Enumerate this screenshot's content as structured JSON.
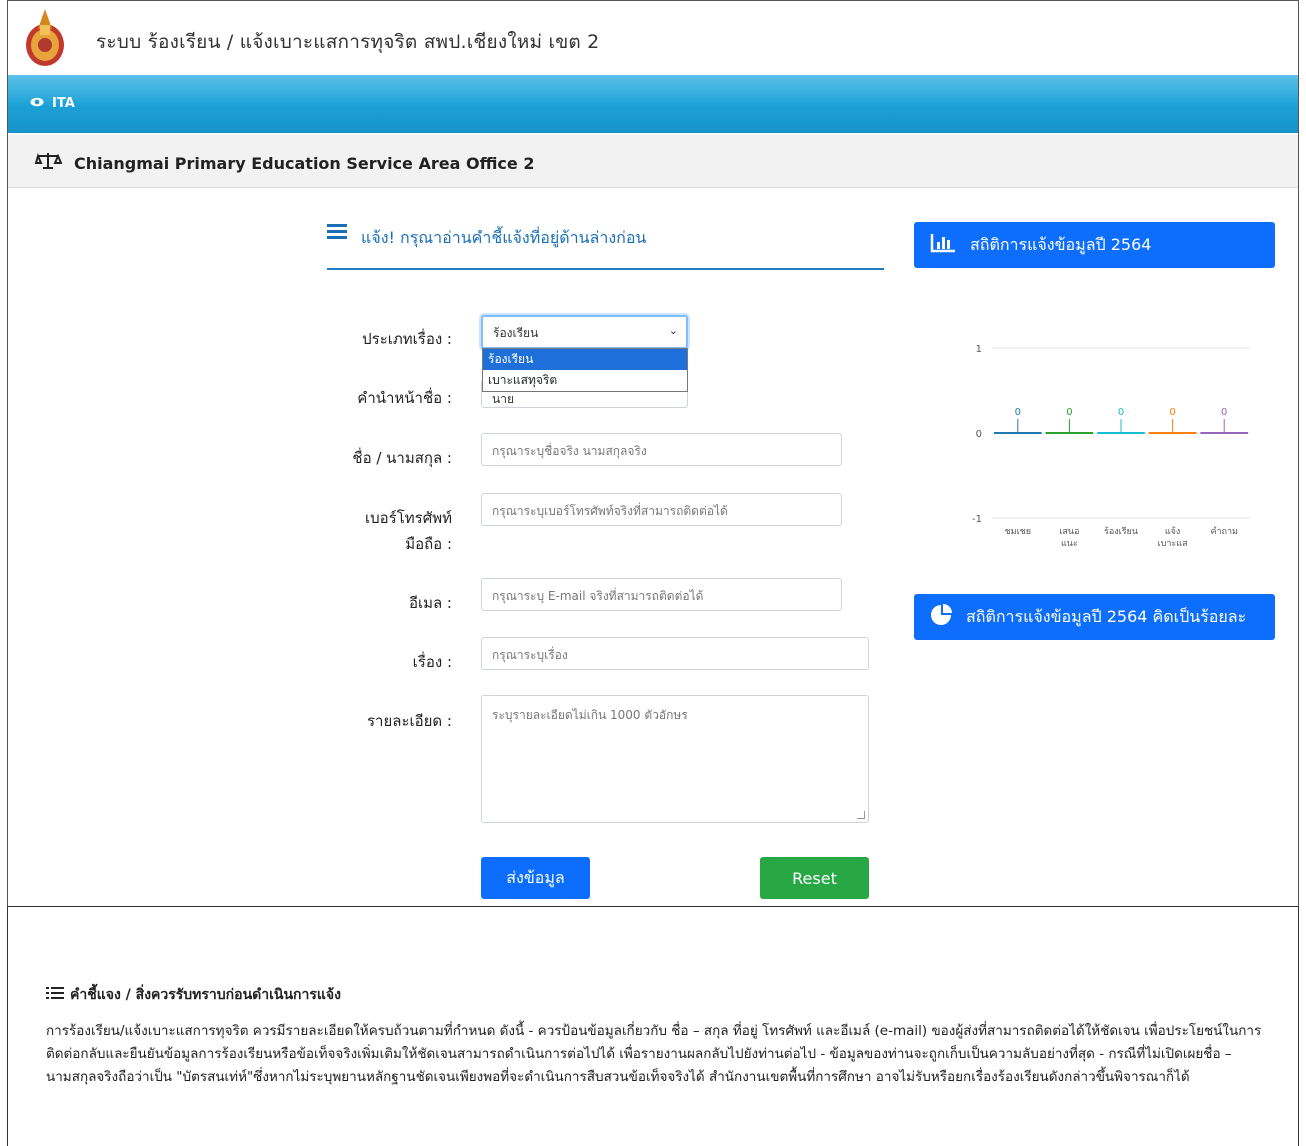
{
  "header": {
    "title": "ระบบ ร้องเรียน / แจ้งเบาะแสการทุจริต  สพป.เชียงใหม่ เขต 2",
    "ita_label": "ITA",
    "office": "Chiangmai Primary Education Service Area Office 2"
  },
  "form": {
    "heading": "แจ้ง! กรุณาอ่านคำชี้แจ้งที่อยู่ด้านล่างก่อน",
    "type_label": "ประเภทเรื่อง :",
    "type_value": "ร้องเรียน",
    "type_options": [
      "ร้องเรียน",
      "เบาะแสทุจริต"
    ],
    "prefix_label": "คำนำหน้าชื่อ :",
    "prefix_value": "นาย",
    "name_label": "ชื่อ / นามสกุล :",
    "name_placeholder": "กรุณาระบุชื่อจริง  นามสกุลจริง",
    "phone_label_1": "เบอร์โทรศัพท์",
    "phone_label_2": "มือถือ :",
    "phone_placeholder": "กรุณาระบุเบอร์โทรศัพท์จริงที่สามารถติดต่อได้",
    "email_label": "อีเมล :",
    "email_placeholder": "กรุณาระบุ E-mail จริงที่สามารถติดต่อได้",
    "subject_label": "เรื่อง :",
    "subject_placeholder": "กรุณาระบุเรื่อง",
    "detail_label": "รายละเอียด :",
    "detail_placeholder": "ระบุรายละเอียดไม่เกิน 1000 ตัวอักษร",
    "submit_label": "ส่งข้อมูล",
    "reset_label": "Reset"
  },
  "stats": {
    "bar_title": "สถิติการแจ้งข้อมูลปี 2564",
    "pie_title": "สถิติการแจ้งข้อมูลปี 2564 คิดเป็นร้อยละ"
  },
  "chart_data": {
    "type": "bar",
    "categories": [
      "ชมเชย",
      "เสนอแนะ",
      "ร้องเรียน",
      "แจ้งเบาะแส",
      "คำถาม"
    ],
    "category_lines": [
      [
        "ชมเชย"
      ],
      [
        "เสนอ",
        "แนะ"
      ],
      [
        "ร้องเรียน"
      ],
      [
        "แจ้ง",
        "เบาะแส"
      ],
      [
        "คำถาม"
      ]
    ],
    "values": [
      0,
      0,
      0,
      0,
      0
    ],
    "ylim": [
      -1,
      1
    ],
    "yticks": [
      1,
      0,
      -1
    ],
    "colors": [
      "#1f77b4",
      "#2ca02c",
      "#17becf",
      "#ff7f0e",
      "#9467bd"
    ]
  },
  "notes": {
    "heading": "คำชี้แจง / สิ่งควรรับทราบก่อนดำเนินการแจ้ง",
    "body": "การร้องเรียน/แจ้งเบาะแสการทุจริต ควรมีรายละเอียดให้ครบถ้วนตามที่กำหนด ดังนี้ - ควรป้อนข้อมูลเกี่ยวกับ ชื่อ – สกุล ที่อยู่ โทรศัพท์ และอีเมล์ (e-mail) ของผู้ส่งที่สามารถติดต่อได้ให้ชัดเจน เพื่อประโยชน์ในการติดต่อกลับและยืนยันข้อมูลการร้องเรียนหรือข้อเท็จจริงเพิ่มเติมให้ชัดเจนสามารถดำเนินการต่อไปได้ เพื่อรายงานผลกลับไปยังท่านต่อไป - ข้อมูลของท่านจะถูกเก็บเป็นความลับอย่างที่สุด - กรณีที่ไม่เปิดเผยชื่อ – นามสกุลจริงถือว่าเป็น \"บัตรสนเท่ห์\"ซึ่งหากไม่ระบุพยานหลักฐานชัดเจนเพียงพอที่จะดำเนินการสืบสวนข้อเท็จจริงได้ สำนักงานเขตพื้นที่การศึกษา อาจไม่รับหรือยกเรื่องร้องเรียนดังกล่าวขึ้นพิจารณาก็ได้"
  }
}
